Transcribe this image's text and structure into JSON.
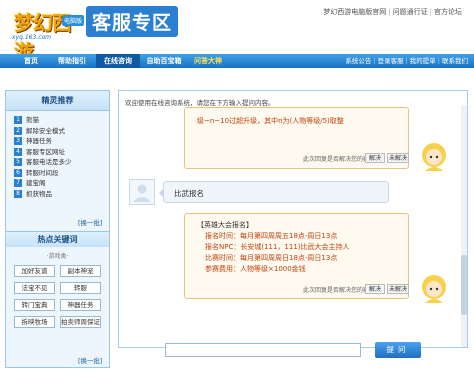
{
  "header": {
    "logo_text": "梦幻西游",
    "logo_badge": "电脑版",
    "logo_url": "xyq.163.com",
    "title": "客服专区",
    "top_links": [
      "梦幻西游电脑版官网",
      "问题通行证",
      "官方论坛"
    ]
  },
  "nav": {
    "tabs": [
      "首页",
      "帮助指引",
      "在线咨询",
      "自助百宝箱",
      "问答大神"
    ],
    "active_tab": "在线咨询",
    "right_links": [
      "系统公告",
      "登录客服",
      "我的提单",
      "联系我们"
    ]
  },
  "sidebar": {
    "title": "精灵推荐",
    "faq_items": [
      {
        "num": "1",
        "text": "熊猫"
      },
      {
        "num": "2",
        "text": "解除安全模式"
      },
      {
        "num": "3",
        "text": "神器任务"
      },
      {
        "num": "4",
        "text": "客服专区网址"
      },
      {
        "num": "5",
        "text": "客服电话是多少"
      },
      {
        "num": "6",
        "text": "转服时间段"
      },
      {
        "num": "7",
        "text": "建宝阁"
      },
      {
        "num": "8",
        "text": "抓获物品"
      }
    ],
    "change_label": "[换一批]",
    "hot_title": "热点关键词",
    "hot_subtitle": "·游戏类·",
    "keywords": [
      "加好友谱",
      "副本神宠",
      "法宝不见",
      "转服",
      "转门宝典",
      "神器任务",
      "拆映牧场",
      "拍卖师周保证"
    ],
    "change_label_2": "[换一批]"
  },
  "chat": {
    "welcome": "欢迎使用在线咨询系统，请您在下方输入提问内容。",
    "bot_msg_1": "级~n~10过超升级，其中n为(人物等级/5)取整",
    "question_prompt": "此次回复是否解决您的疑问：",
    "solved_label": "解决",
    "unsolved_label": "未解决",
    "user_msg": "比武报名",
    "bot_msg_2": {
      "title": "【英雄大会报名】",
      "lines": [
        "报名时间：每月第四周周五18点-周日13点",
        "报名NPC：长安城(111，111)比武大会主持人",
        "比赛时间：每月第四周周日18点-周日13点",
        "参赛费用：人物等级×1000金钱"
      ]
    }
  },
  "input": {
    "value": "",
    "send_label": "提问"
  },
  "colors": {
    "brand_blue": "#1a72c2",
    "bot_text": "#c2410c",
    "bot_bubble_border": "#e7c27e"
  }
}
